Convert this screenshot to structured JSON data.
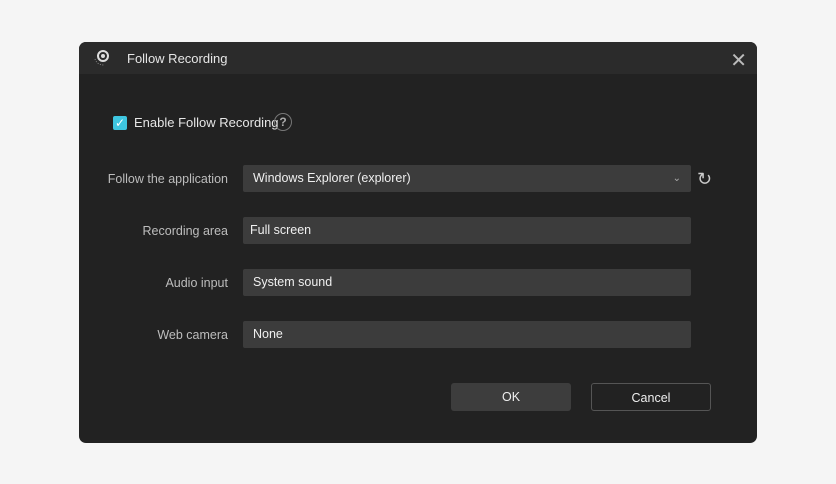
{
  "title": "Follow Recording",
  "enable": {
    "label": "Enable Follow Recording",
    "checked": true
  },
  "fields": [
    {
      "label": "Follow the application",
      "value": "Windows Explorer (explorer)"
    },
    {
      "label": "Recording area",
      "value": "Full screen"
    },
    {
      "label": "Audio input",
      "value": "System sound"
    },
    {
      "label": "Web camera",
      "value": "None"
    }
  ],
  "buttons": {
    "ok": "OK",
    "cancel": "Cancel"
  },
  "icons": {
    "help": "?",
    "close": "✕",
    "refresh": "↻",
    "check": "✓"
  }
}
